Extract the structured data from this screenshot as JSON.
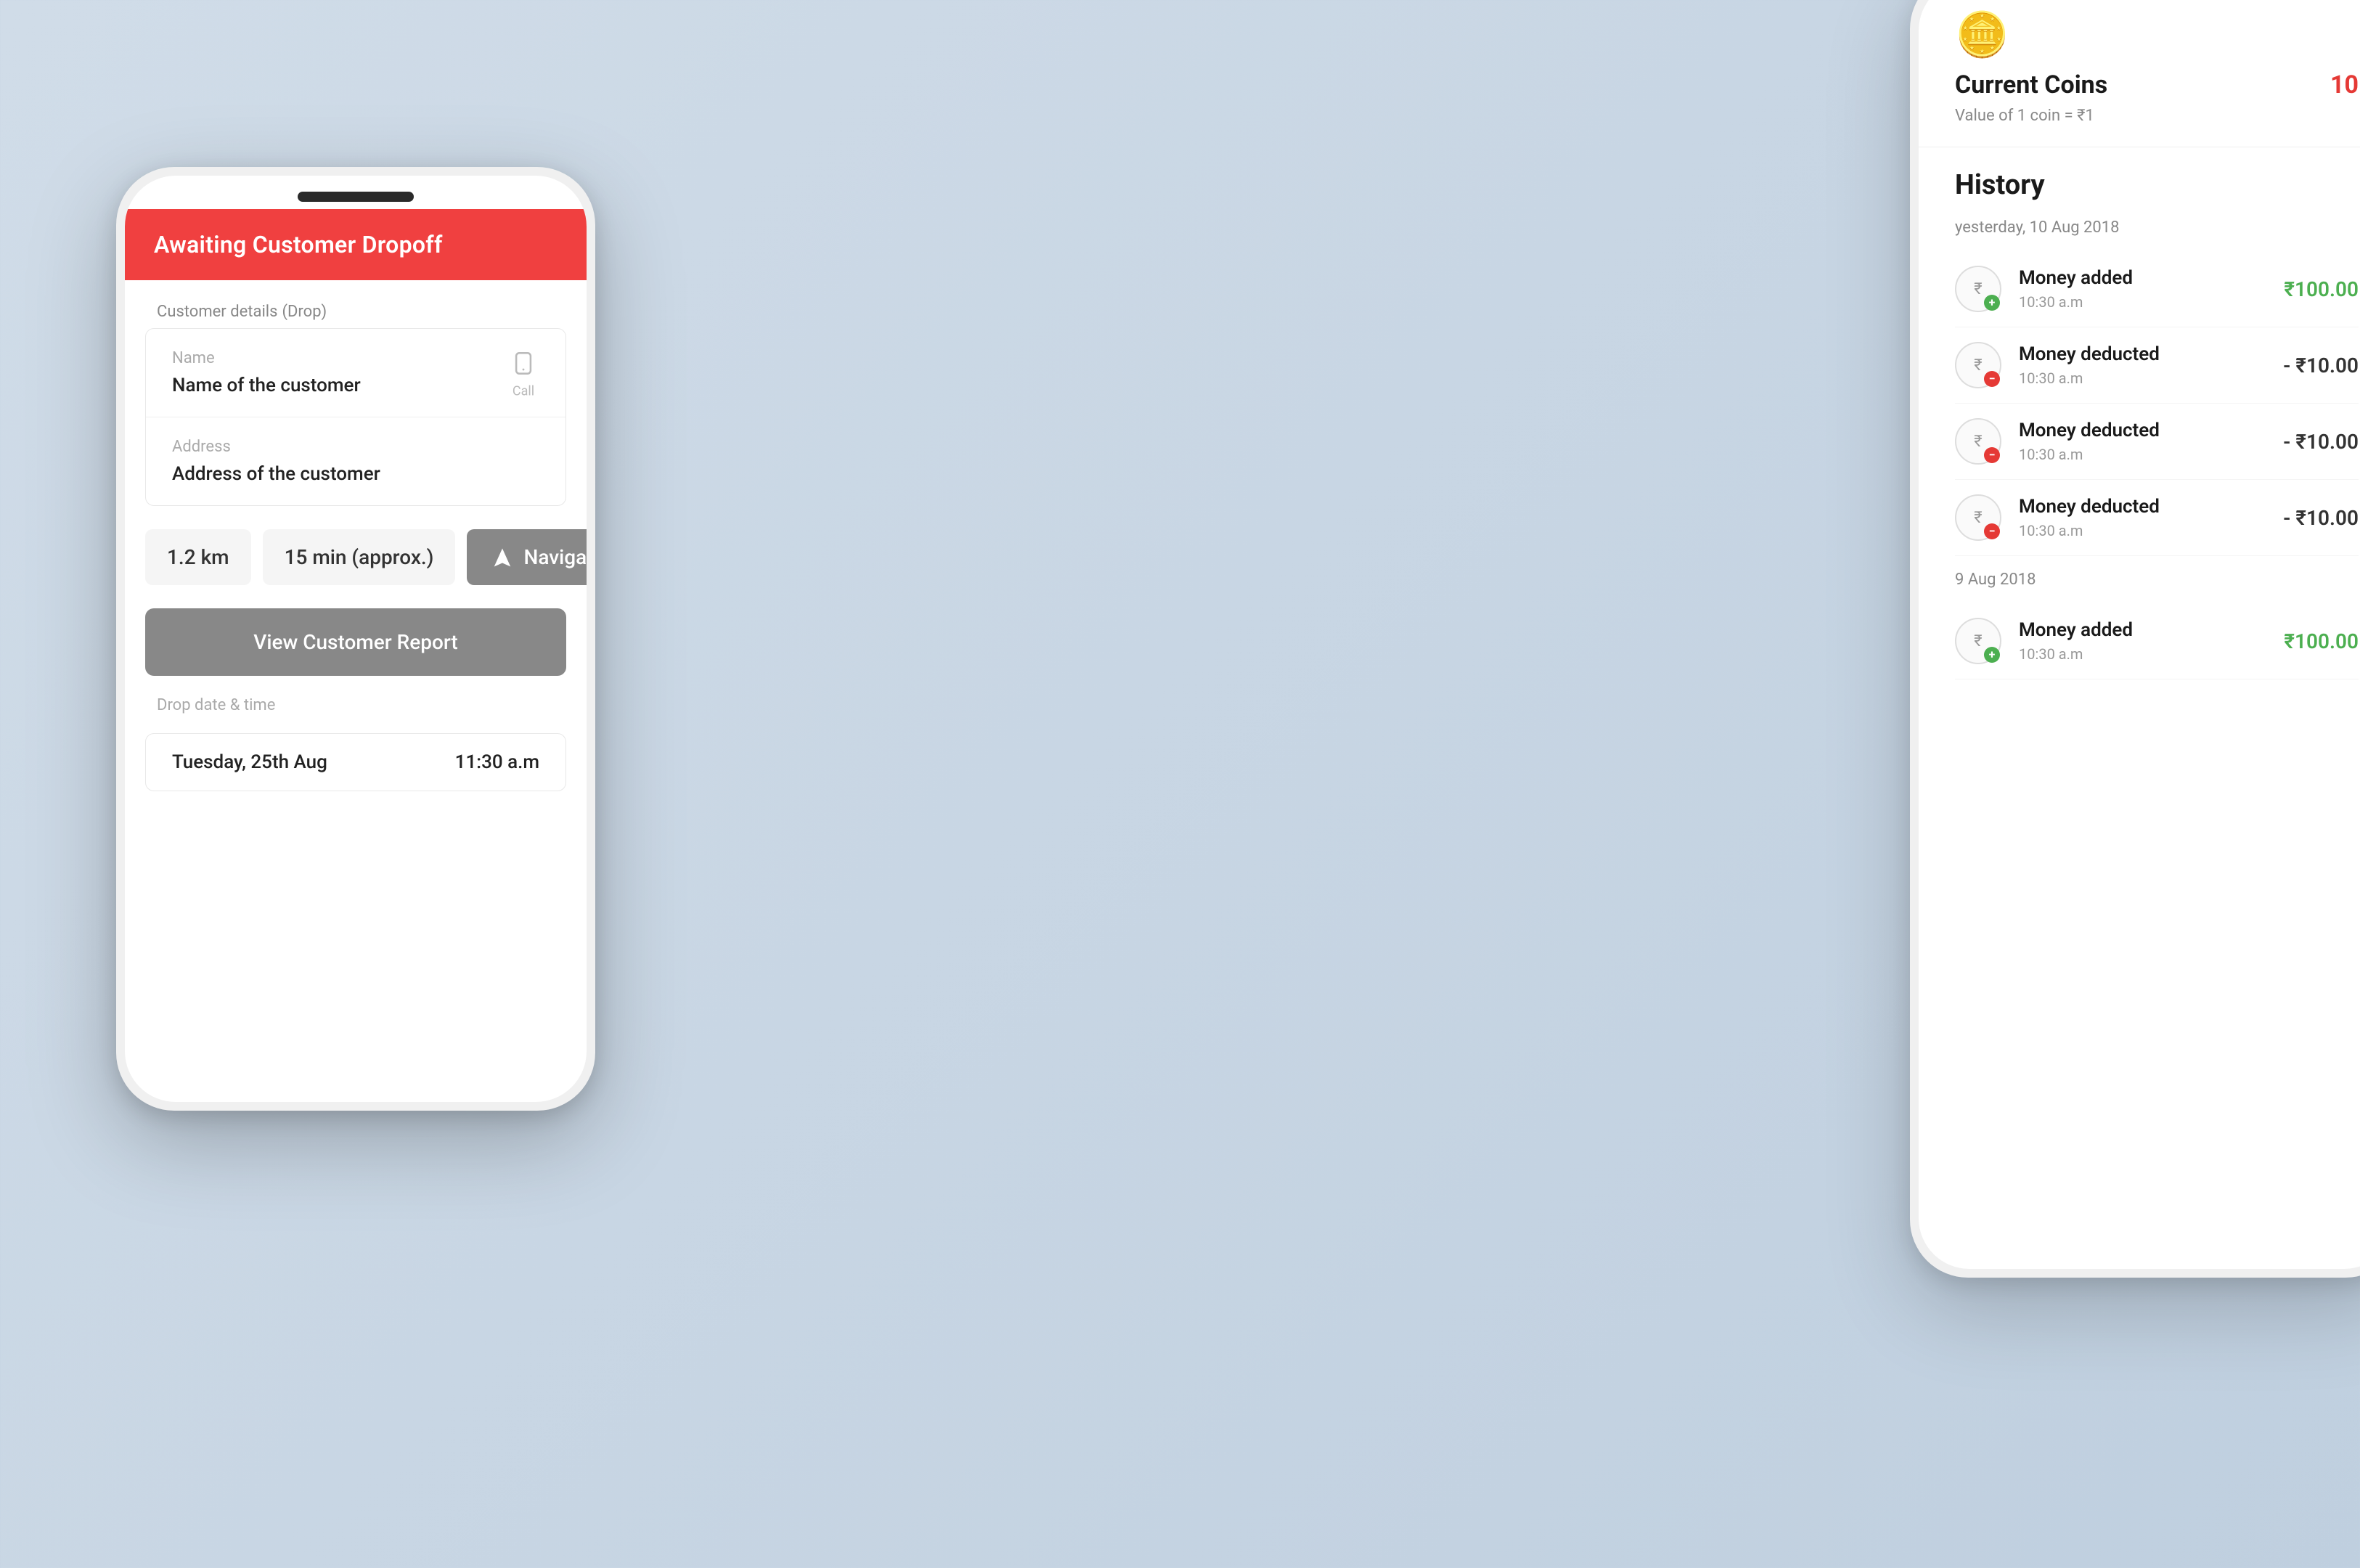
{
  "phone_left": {
    "notch": "notch",
    "status_bar": "Awaiting Customer Dropoff",
    "section_title": "Customer details",
    "section_subtitle": "(Drop)",
    "name_label": "Name",
    "name_value": "Name of the customer",
    "call_label": "Call",
    "address_label": "Address",
    "address_value": "Address of the customer",
    "distance": "1.2 km",
    "duration": "15 min (approx.)",
    "navigate": "Navigate",
    "view_report": "View Customer Report",
    "drop_label": "Drop date & time",
    "drop_date": "Tuesday, 25th  Aug",
    "drop_time": "11:30 a.m"
  },
  "phone_right": {
    "coin_emoji": "🪙",
    "current_coins_label": "Current Coins",
    "current_coins_value": "10",
    "coin_value_label": "Value of 1 coin = ₹1",
    "history_title": "History",
    "history_date_1": "yesterday, 10 Aug 2018",
    "history_date_2": "9 Aug 2018",
    "history_items": [
      {
        "type": "added",
        "title": "Money added",
        "time": "10:30 a.m",
        "amount": "₹100.00",
        "sign": "+"
      },
      {
        "type": "deducted",
        "title": "Money deducted",
        "time": "10:30 a.m",
        "amount": "- ₹10.00",
        "sign": "-"
      },
      {
        "type": "deducted",
        "title": "Money deducted",
        "time": "10:30 a.m",
        "amount": "- ₹10.00",
        "sign": "-"
      },
      {
        "type": "deducted",
        "title": "Money deducted",
        "time": "10:30 a.m",
        "amount": "- ₹10.00",
        "sign": "-"
      },
      {
        "type": "added",
        "title": "Money added",
        "time": "10:30 a.m",
        "amount": "₹100.00",
        "sign": "+"
      }
    ]
  }
}
